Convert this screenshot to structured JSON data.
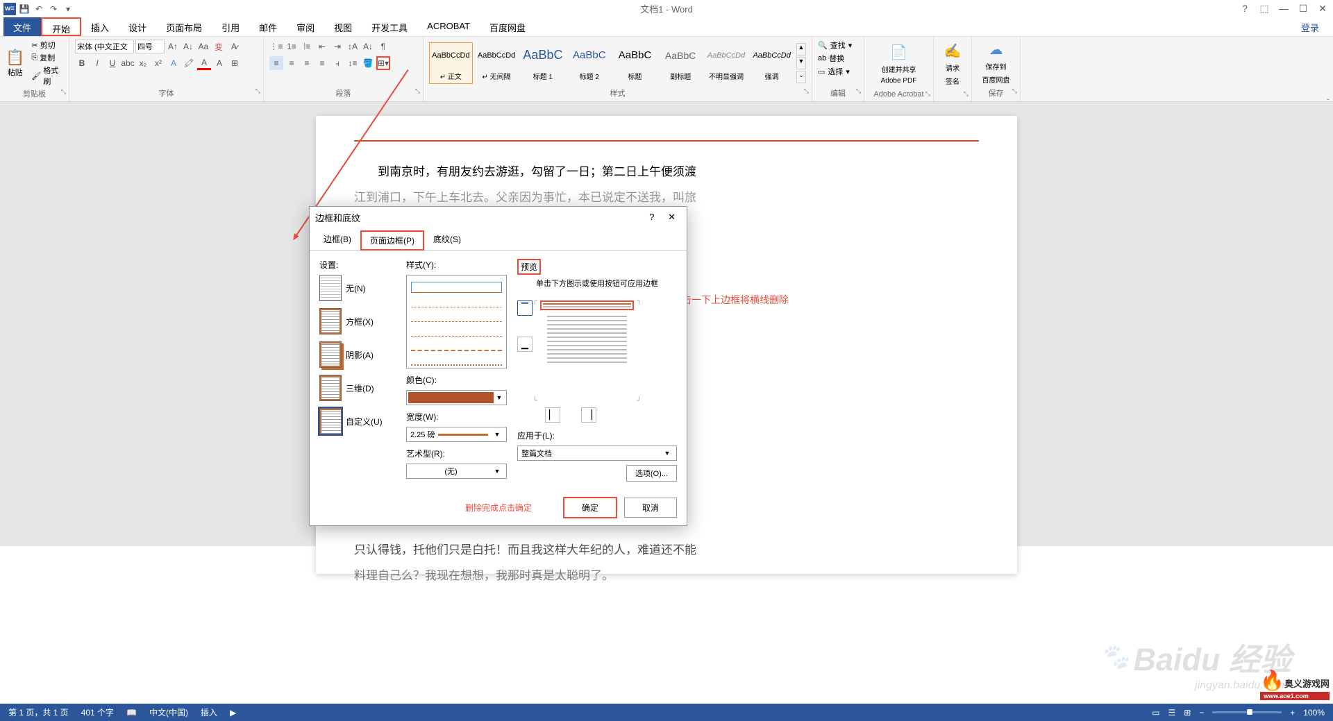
{
  "titlebar": {
    "title": "文档1 - Word"
  },
  "menu": {
    "tabs": [
      "文件",
      "开始",
      "插入",
      "设计",
      "页面布局",
      "引用",
      "邮件",
      "审阅",
      "视图",
      "开发工具",
      "ACROBAT",
      "百度网盘"
    ],
    "login": "登录"
  },
  "ribbon": {
    "clipboard": {
      "paste": "粘贴",
      "cut": "剪切",
      "copy": "复制",
      "formatpainter": "格式刷",
      "label": "剪贴板"
    },
    "font": {
      "name": "宋体 (中文正文",
      "size": "四号",
      "label": "字体"
    },
    "paragraph": {
      "label": "段落"
    },
    "styles": {
      "label": "样式",
      "items": [
        {
          "preview": "AaBbCcDd",
          "name": "↵ 正文",
          "class": "active"
        },
        {
          "preview": "AaBbCcDd",
          "name": "↵ 无间隔"
        },
        {
          "preview": "AaBbC",
          "name": "标题 1",
          "size": "16px"
        },
        {
          "preview": "AaBbC",
          "name": "标题 2",
          "size": "14px"
        },
        {
          "preview": "AaBbC",
          "name": "标题",
          "size": "14px"
        },
        {
          "preview": "AaBbC",
          "name": "副标题",
          "size": "14px"
        },
        {
          "preview": "AaBbCcDd",
          "name": "不明显强调",
          "style": "italic"
        },
        {
          "preview": "AaBbCcDd",
          "name": "强调",
          "style": "italic"
        }
      ]
    },
    "editing": {
      "find": "查找",
      "replace": "替换",
      "select": "选择",
      "label": "编辑"
    },
    "acrobat": {
      "line1": "创建并共享",
      "line2": "Adobe PDF",
      "label": "Adobe Acrobat"
    },
    "sign": {
      "line1": "请求",
      "line2": "签名"
    },
    "baidu": {
      "line1": "保存到",
      "line2": "百度网盘",
      "label": "保存"
    }
  },
  "document": {
    "text1": "到南京时，有朋友约去游逛，勾留了一日；第二日上午便须渡",
    "text2": "江到浦口，下午上车北去。父亲因为事忙，本已说定不送我，叫旅",
    "text3": "只认得钱，托他们只是白托！而且我这样大年纪的人，难道还不能",
    "text4": "料理自己么？我现在想想，我那时真是太聪明了。"
  },
  "dialog": {
    "title": "边框和底纹",
    "tabs": {
      "border": "边框(B)",
      "pageborder": "页面边框(P)",
      "shading": "底纹(S)"
    },
    "settings": {
      "label": "设置:",
      "none": "无(N)",
      "box": "方框(X)",
      "shadow": "阴影(A)",
      "threed": "三维(D)",
      "custom": "自定义(U)"
    },
    "style": {
      "label": "样式(Y):",
      "color_label": "颜色(C):",
      "width_label": "宽度(W):",
      "width_value": "2.25 磅",
      "art_label": "艺术型(R):",
      "art_value": "(无)"
    },
    "preview": {
      "label": "预览",
      "hint": "单击下方图示或使用按钮可应用边框",
      "apply_label": "应用于(L):",
      "apply_value": "整篇文档",
      "options": "选项(O)..."
    },
    "footer": {
      "note": "删除完成点击确定",
      "ok": "确定",
      "cancel": "取消"
    }
  },
  "annotations": {
    "top_border": "点击一下上边框将横线删除"
  },
  "statusbar": {
    "page": "第 1 页，共 1 页",
    "words": "401 个字",
    "lang": "中文(中国)",
    "mode": "插入",
    "zoom": "100%"
  },
  "watermark": {
    "baidu": "Baidu 经验",
    "baidu_sub": "jingyan.baidu.com",
    "logo_text": "奥义游戏网",
    "logo_url": "www.aoe1.com"
  }
}
